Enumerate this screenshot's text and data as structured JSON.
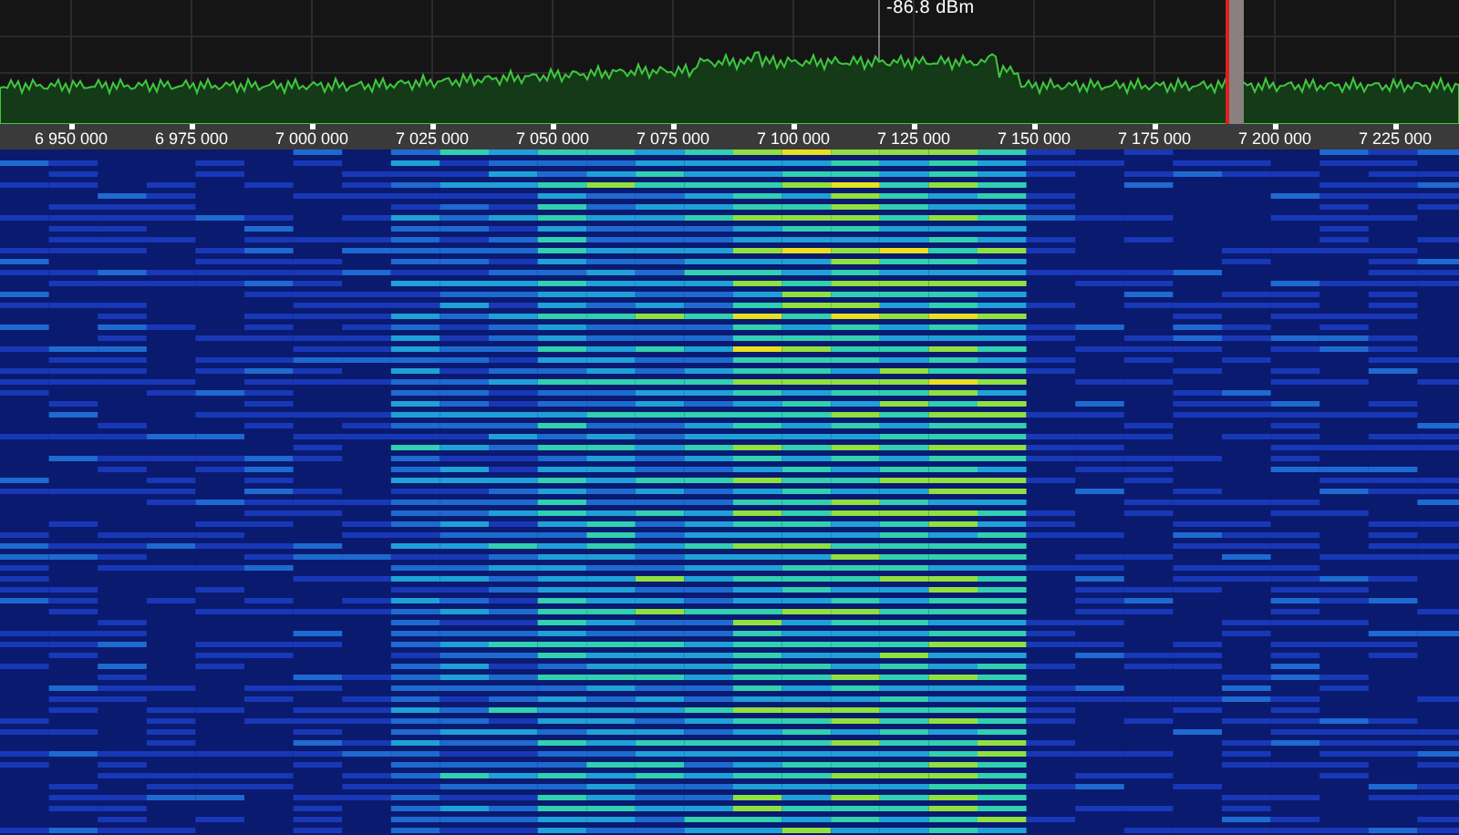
{
  "spectrum": {
    "readout": "-86.8 dBm"
  },
  "frequency_axis": {
    "labels": [
      "6 950 000",
      "6 975 000",
      "7 000 000",
      "7 025 000",
      "7 050 000",
      "7 075 000",
      "7 100 000",
      "7 125 000",
      "7 150 000",
      "7 175 000",
      "7 200 000",
      "7 225 000"
    ]
  }
}
